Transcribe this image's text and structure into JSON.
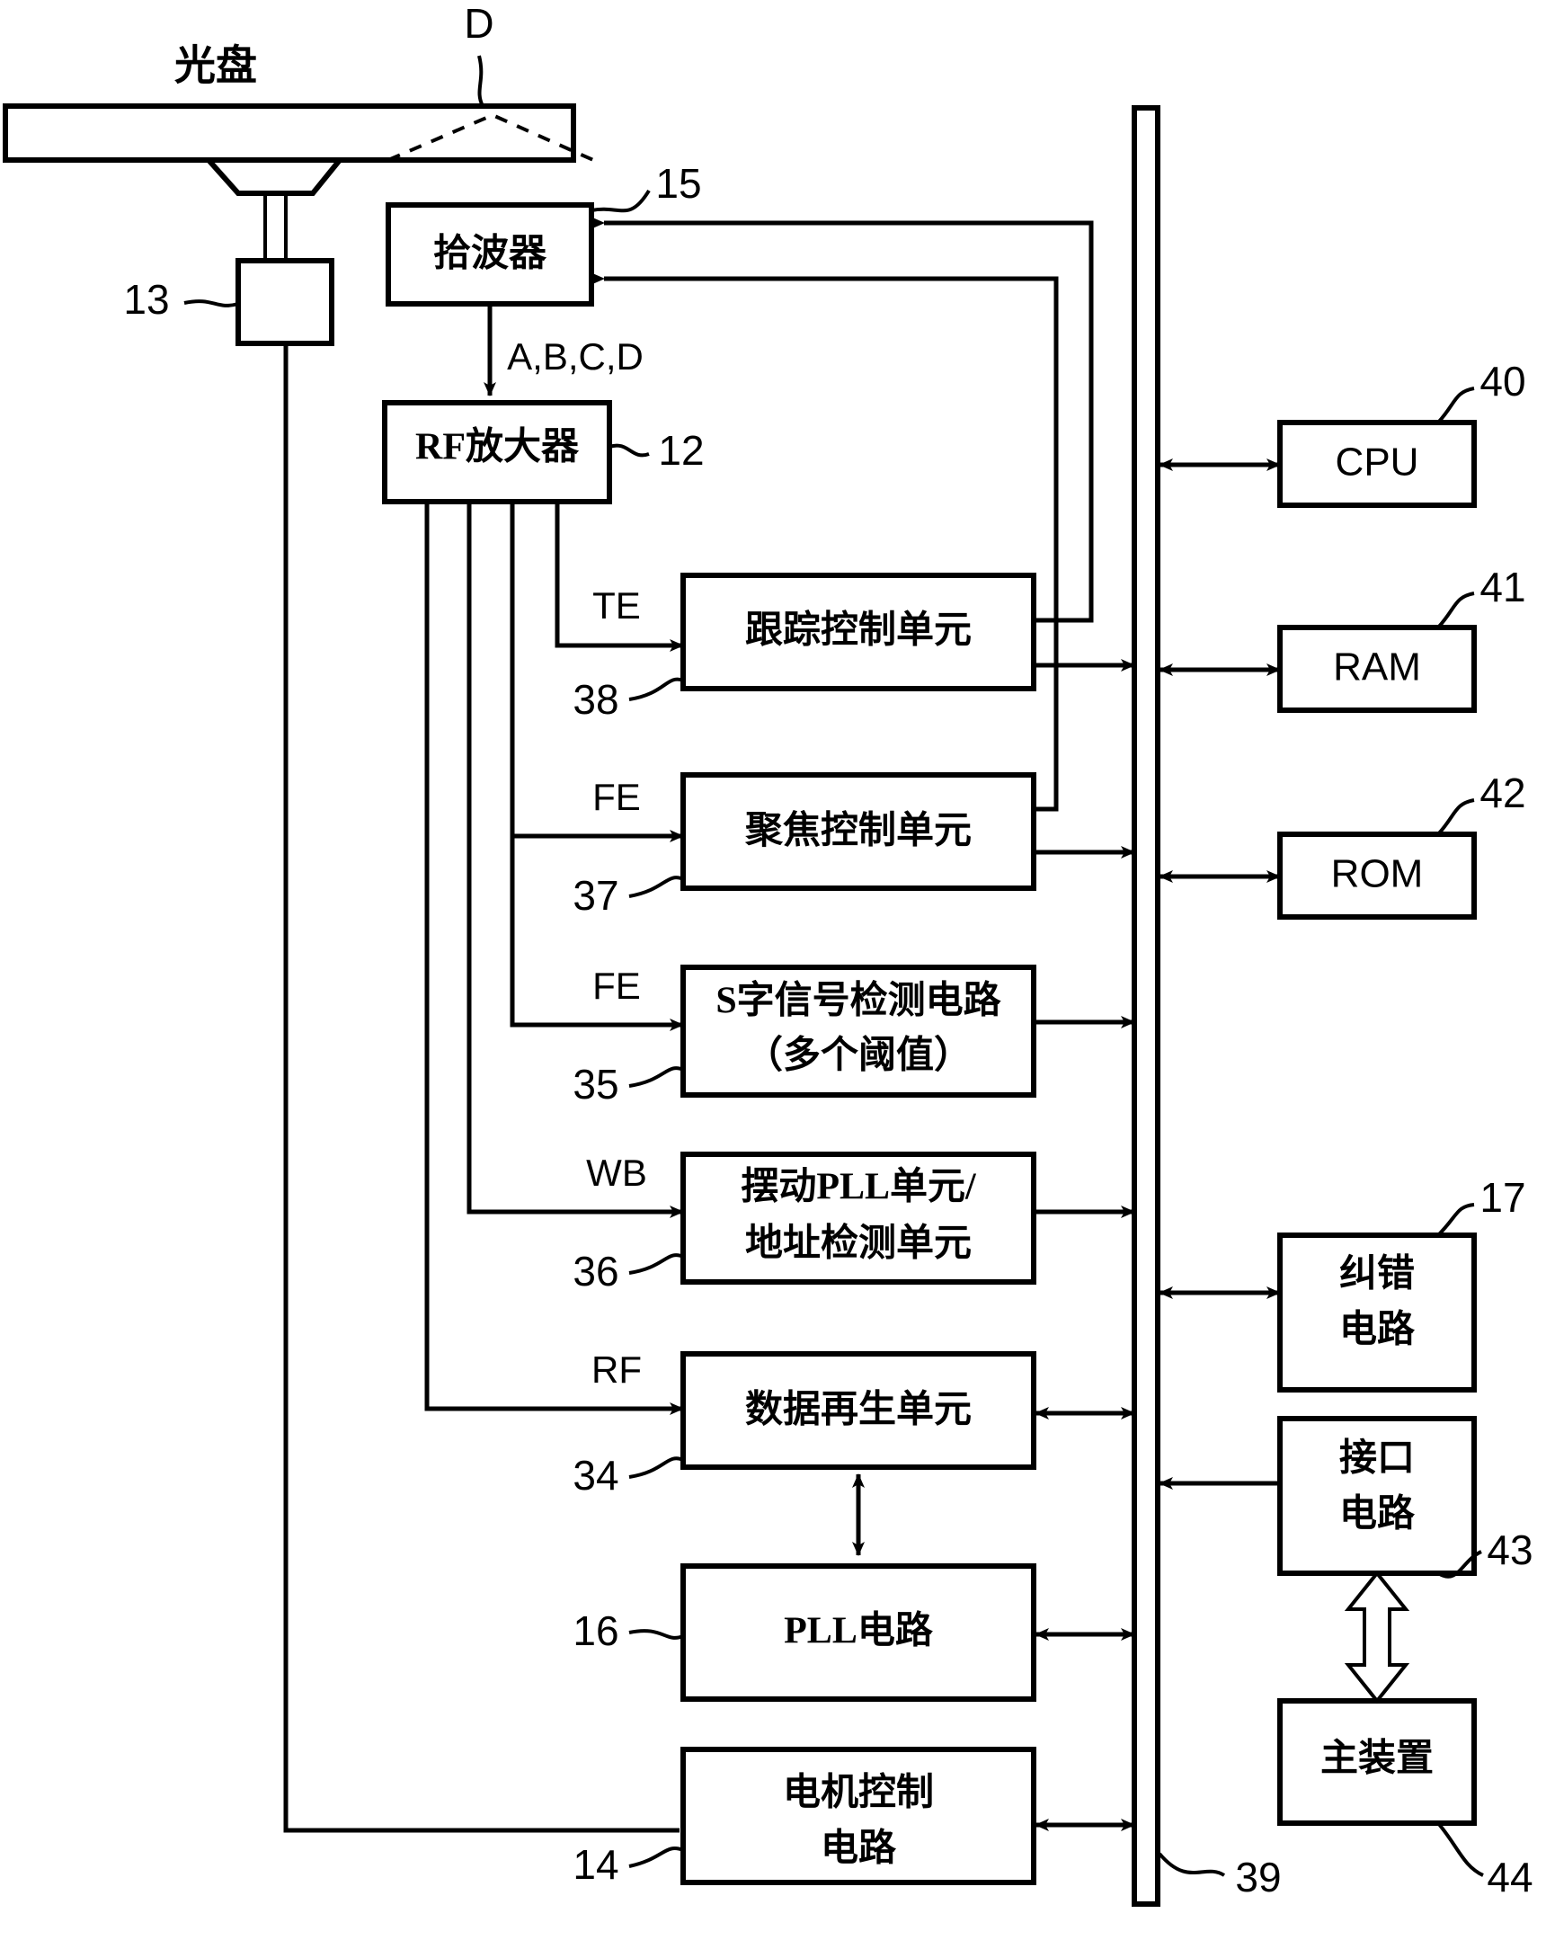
{
  "figure": {
    "type": "block-diagram",
    "subject": "optical disc drive signal processing block diagram",
    "disc_label": "光盘",
    "disc_ref": "D"
  },
  "blocks": {
    "pickup": {
      "label": "拾波器",
      "ref": "15"
    },
    "spindle": {
      "label": "",
      "ref": "13"
    },
    "rf_amp": {
      "label": "RF放大器",
      "ref": "12"
    },
    "tracking": {
      "label": "跟踪控制单元",
      "ref": "38"
    },
    "focus": {
      "label": "聚焦控制单元",
      "ref": "37"
    },
    "s_detect": {
      "label_line1": "S字信号检测电路",
      "label_line2": "（多个阈值）",
      "ref": "35"
    },
    "wobble": {
      "label_line1": "摆动PLL单元/",
      "label_line2": "地址检测单元",
      "ref": "36"
    },
    "data_regen": {
      "label": "数据再生单元",
      "ref": "34"
    },
    "pll": {
      "label": "PLL电路",
      "ref": "16"
    },
    "motor": {
      "label_line1": "电机控制",
      "label_line2": "电路",
      "ref": "14"
    },
    "cpu": {
      "label": "CPU",
      "ref": "40"
    },
    "ram": {
      "label": "RAM",
      "ref": "41"
    },
    "rom": {
      "label": "ROM",
      "ref": "42"
    },
    "ecc": {
      "label_line1": "纠错",
      "label_line2": "电路",
      "ref": "17"
    },
    "interface": {
      "label_line1": "接口",
      "label_line2": "电路",
      "ref": "43"
    },
    "host": {
      "label": "主装置",
      "ref": "44"
    },
    "bus": {
      "label": "",
      "ref": "39"
    }
  },
  "signals": {
    "abcd": "A,B,C,D",
    "te": "TE",
    "fe_focus": "FE",
    "fe_sdetect": "FE",
    "wb": "WB",
    "rf": "RF"
  },
  "colors": {
    "ink": "#000000",
    "paper": "#ffffff"
  }
}
